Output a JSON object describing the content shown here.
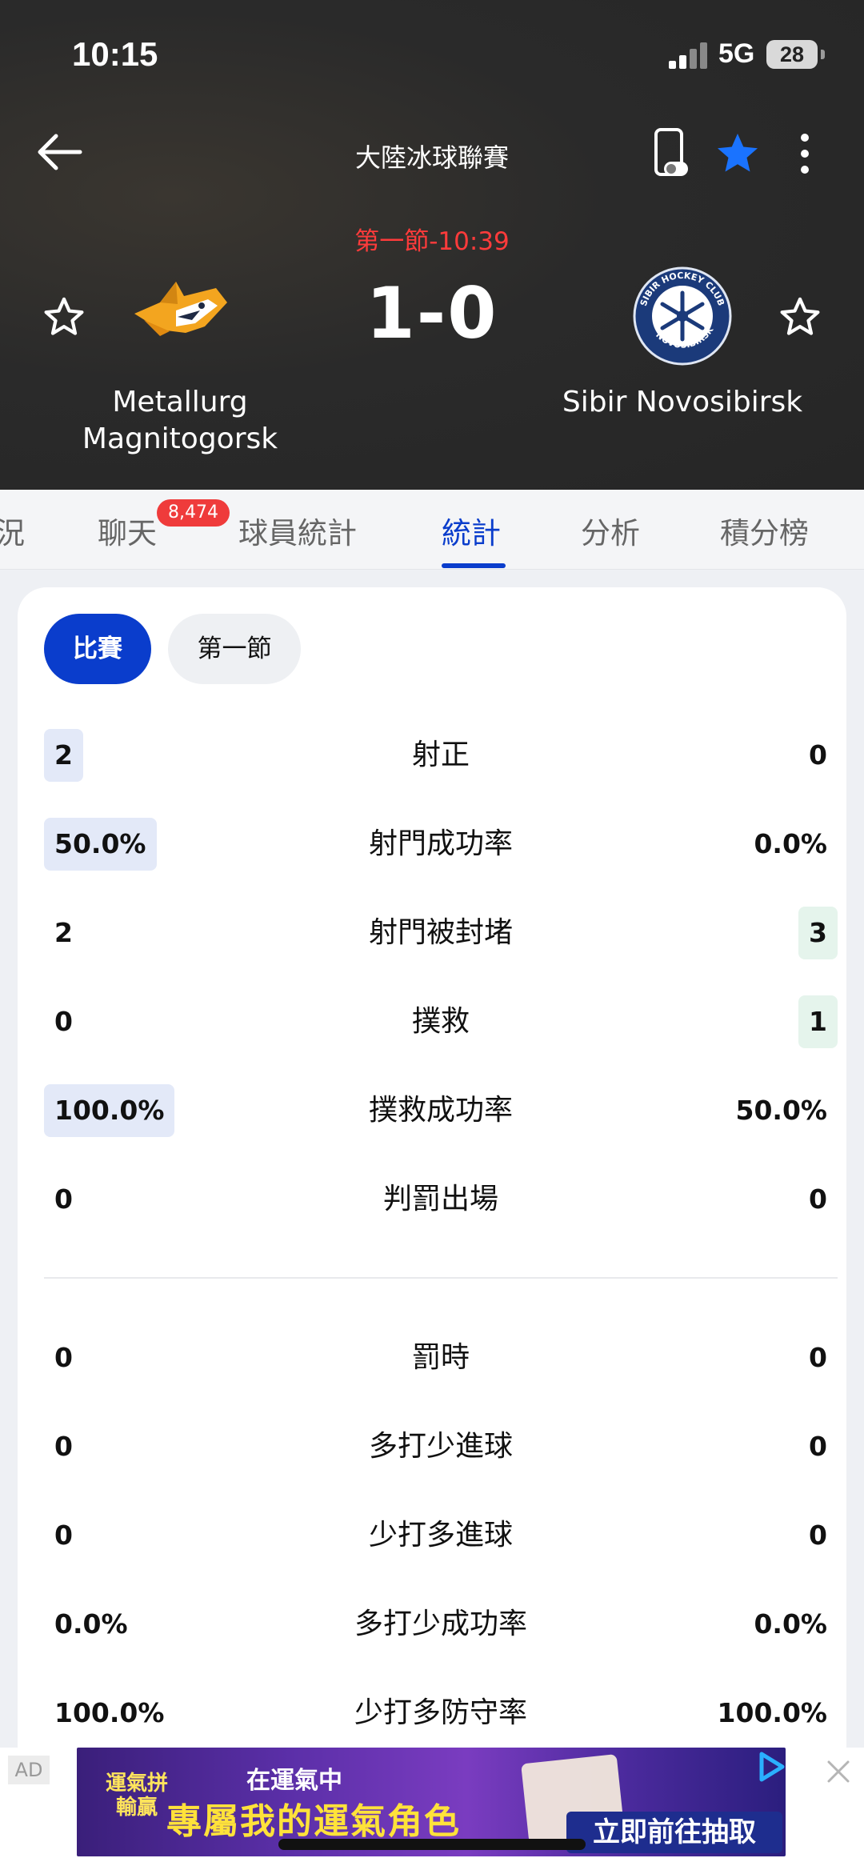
{
  "status_bar": {
    "time": "10:15",
    "network": "5G",
    "battery": "28"
  },
  "header": {
    "league": "大陸冰球聯賽",
    "period_clock": "第一節-10:39",
    "score": "1-0",
    "home_team": "Metallurg Magnitogorsk",
    "away_team": "Sibir Novosibirsk",
    "away_logo_text": "SIBIR HOCKEY CLUB NOVOSIBIRSK",
    "fav_color": "#1a73ff"
  },
  "tabs": {
    "items": [
      "況",
      "聊天",
      "球員統計",
      "統計",
      "分析",
      "積分榜"
    ],
    "active": "統計",
    "chat_badge": "8,474"
  },
  "filters": {
    "match": "比賽",
    "period1": "第一節"
  },
  "stats": [
    {
      "label": "射正",
      "home": "2",
      "away": "0",
      "highlight": "home"
    },
    {
      "label": "射門成功率",
      "home": "50.0%",
      "away": "0.0%",
      "highlight": "home"
    },
    {
      "label": "射門被封堵",
      "home": "2",
      "away": "3",
      "highlight": "away"
    },
    {
      "label": "撲救",
      "home": "0",
      "away": "1",
      "highlight": "away"
    },
    {
      "label": "撲救成功率",
      "home": "100.0%",
      "away": "50.0%",
      "highlight": "home"
    },
    {
      "label": "判罰出場",
      "home": "0",
      "away": "0",
      "highlight": "none"
    }
  ],
  "stats2": [
    {
      "label": "罰時",
      "home": "0",
      "away": "0"
    },
    {
      "label": "多打少進球",
      "home": "0",
      "away": "0"
    },
    {
      "label": "少打多進球",
      "home": "0",
      "away": "0"
    },
    {
      "label": "多打少成功率",
      "home": "0.0%",
      "away": "0.0%"
    },
    {
      "label": "少打多防守率",
      "home": "100.0%",
      "away": "100.0%"
    }
  ],
  "ad": {
    "label": "AD",
    "brand": "運氣拼輸贏",
    "tagline": "在運氣中",
    "headline": "專屬我的運氣角色",
    "cta": "立即前往抽取"
  },
  "colors": {
    "accent": "#0a3dcc",
    "live_red": "#ff3b3b",
    "home_highlight": "#e3e9f8",
    "away_highlight": "#e5f4ec"
  }
}
